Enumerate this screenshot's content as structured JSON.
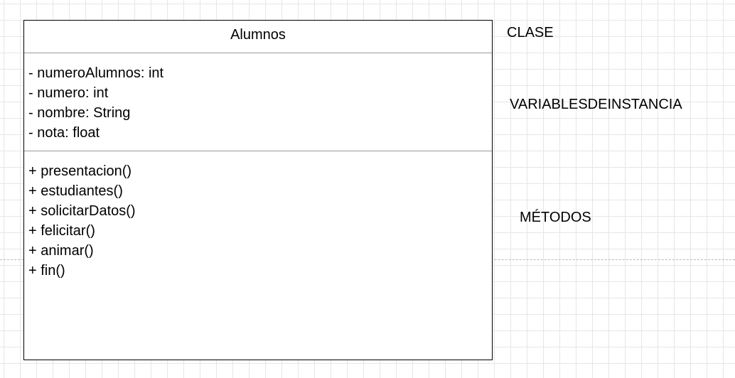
{
  "diagram": {
    "class_name": "Alumnos",
    "attributes": [
      "- numeroAlumnos: int",
      "- numero: int",
      "- nombre: String",
      "- nota: float"
    ],
    "methods": [
      "+ presentacion()",
      "+ estudiantes()",
      "+ solicitarDatos()",
      "+ felicitar()",
      "+ animar()",
      "+ fin()"
    ]
  },
  "labels": {
    "clase": "CLASE",
    "variables": "VARIABLESDEINSTANCIA",
    "metodos": "MÉTODOS"
  },
  "colors": {
    "border": "#000000",
    "divider": "#9a9a9a",
    "grid": "#e6e6e6",
    "page_break": "#b8b8b8"
  }
}
